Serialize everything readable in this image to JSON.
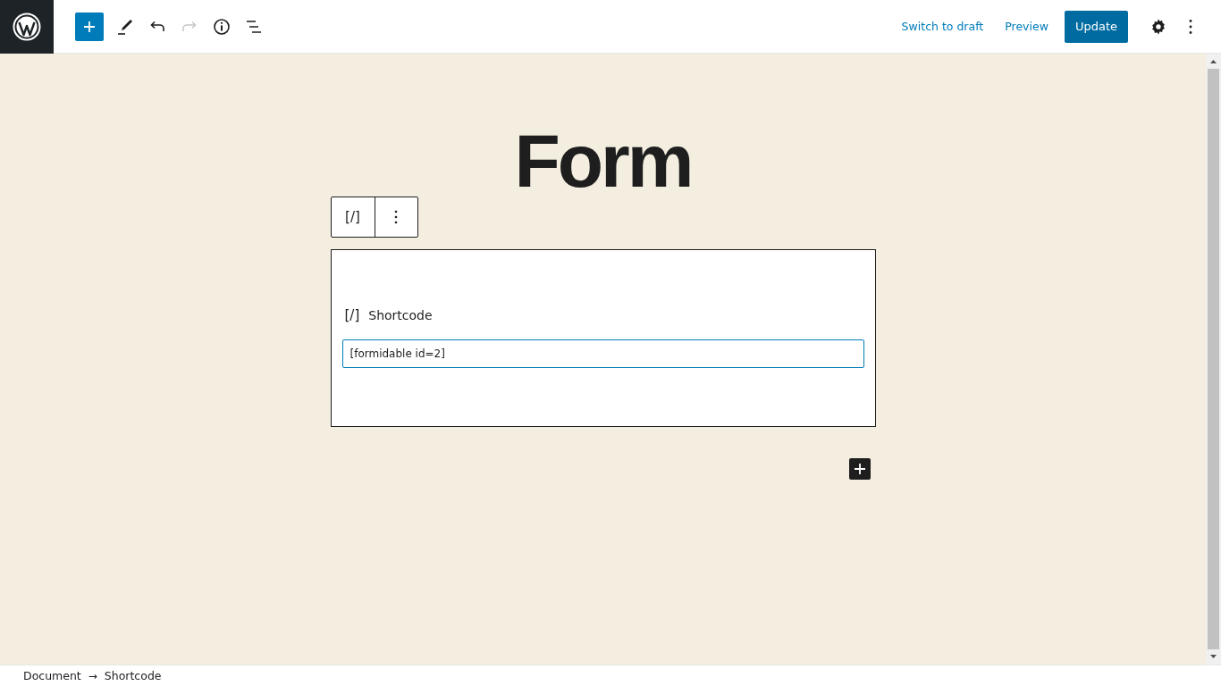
{
  "toolbar": {
    "undo_disabled": false,
    "redo_disabled": true
  },
  "header_actions": [
    {
      "label": "Switch to draft",
      "kind": "link"
    },
    {
      "label": "Preview",
      "kind": "link"
    },
    {
      "label": "Update",
      "kind": "primary"
    }
  ],
  "post_title": "Form",
  "block_toolbar": {
    "block_icon": "[/]"
  },
  "block": {
    "icon": "[/]",
    "label": "Shortcode",
    "value": "[formidable id=2]"
  },
  "breadcrumb": [
    {
      "label": "Document"
    },
    {
      "label": "Shortcode"
    }
  ],
  "breadcrumb_separator": "→"
}
